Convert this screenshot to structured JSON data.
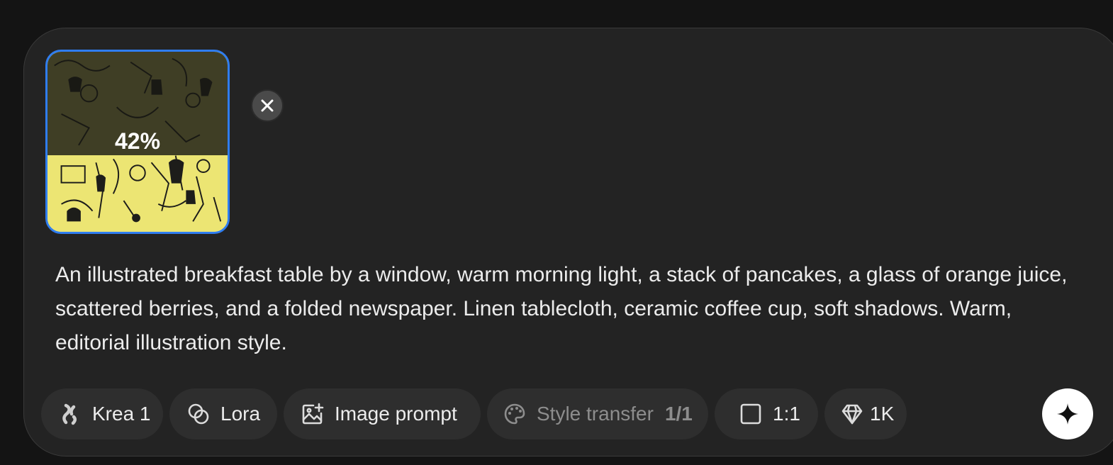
{
  "upload": {
    "progress_percent": 42,
    "progress_label": "42%",
    "close_icon": "close-icon",
    "accent_border": "#2f7df0",
    "image_color": "#ece573"
  },
  "prompt": {
    "text": "An illustrated breakfast table by a window, warm morning light, a stack of pancakes, a glass of orange juice, scattered berries, and a folded newspaper. Linen tablecloth, ceramic coffee cup, soft shadows. Warm, editorial illustration style."
  },
  "toolbar": {
    "model": {
      "label": "Krea 1",
      "icon": "krea-logo-icon"
    },
    "lora": {
      "label": "Lora",
      "icon": "lora-icon"
    },
    "image_prompt": {
      "label": "Image prompt",
      "icon": "image-add-icon"
    },
    "style_transfer": {
      "label": "Style transfer",
      "count": "1/1",
      "icon": "palette-icon",
      "disabled": true
    },
    "aspect_ratio": {
      "label": "1:1",
      "icon": "square-icon"
    },
    "resolution": {
      "label": "1K",
      "icon": "diamond-icon"
    },
    "generate": {
      "icon": "sparkle-icon"
    }
  }
}
